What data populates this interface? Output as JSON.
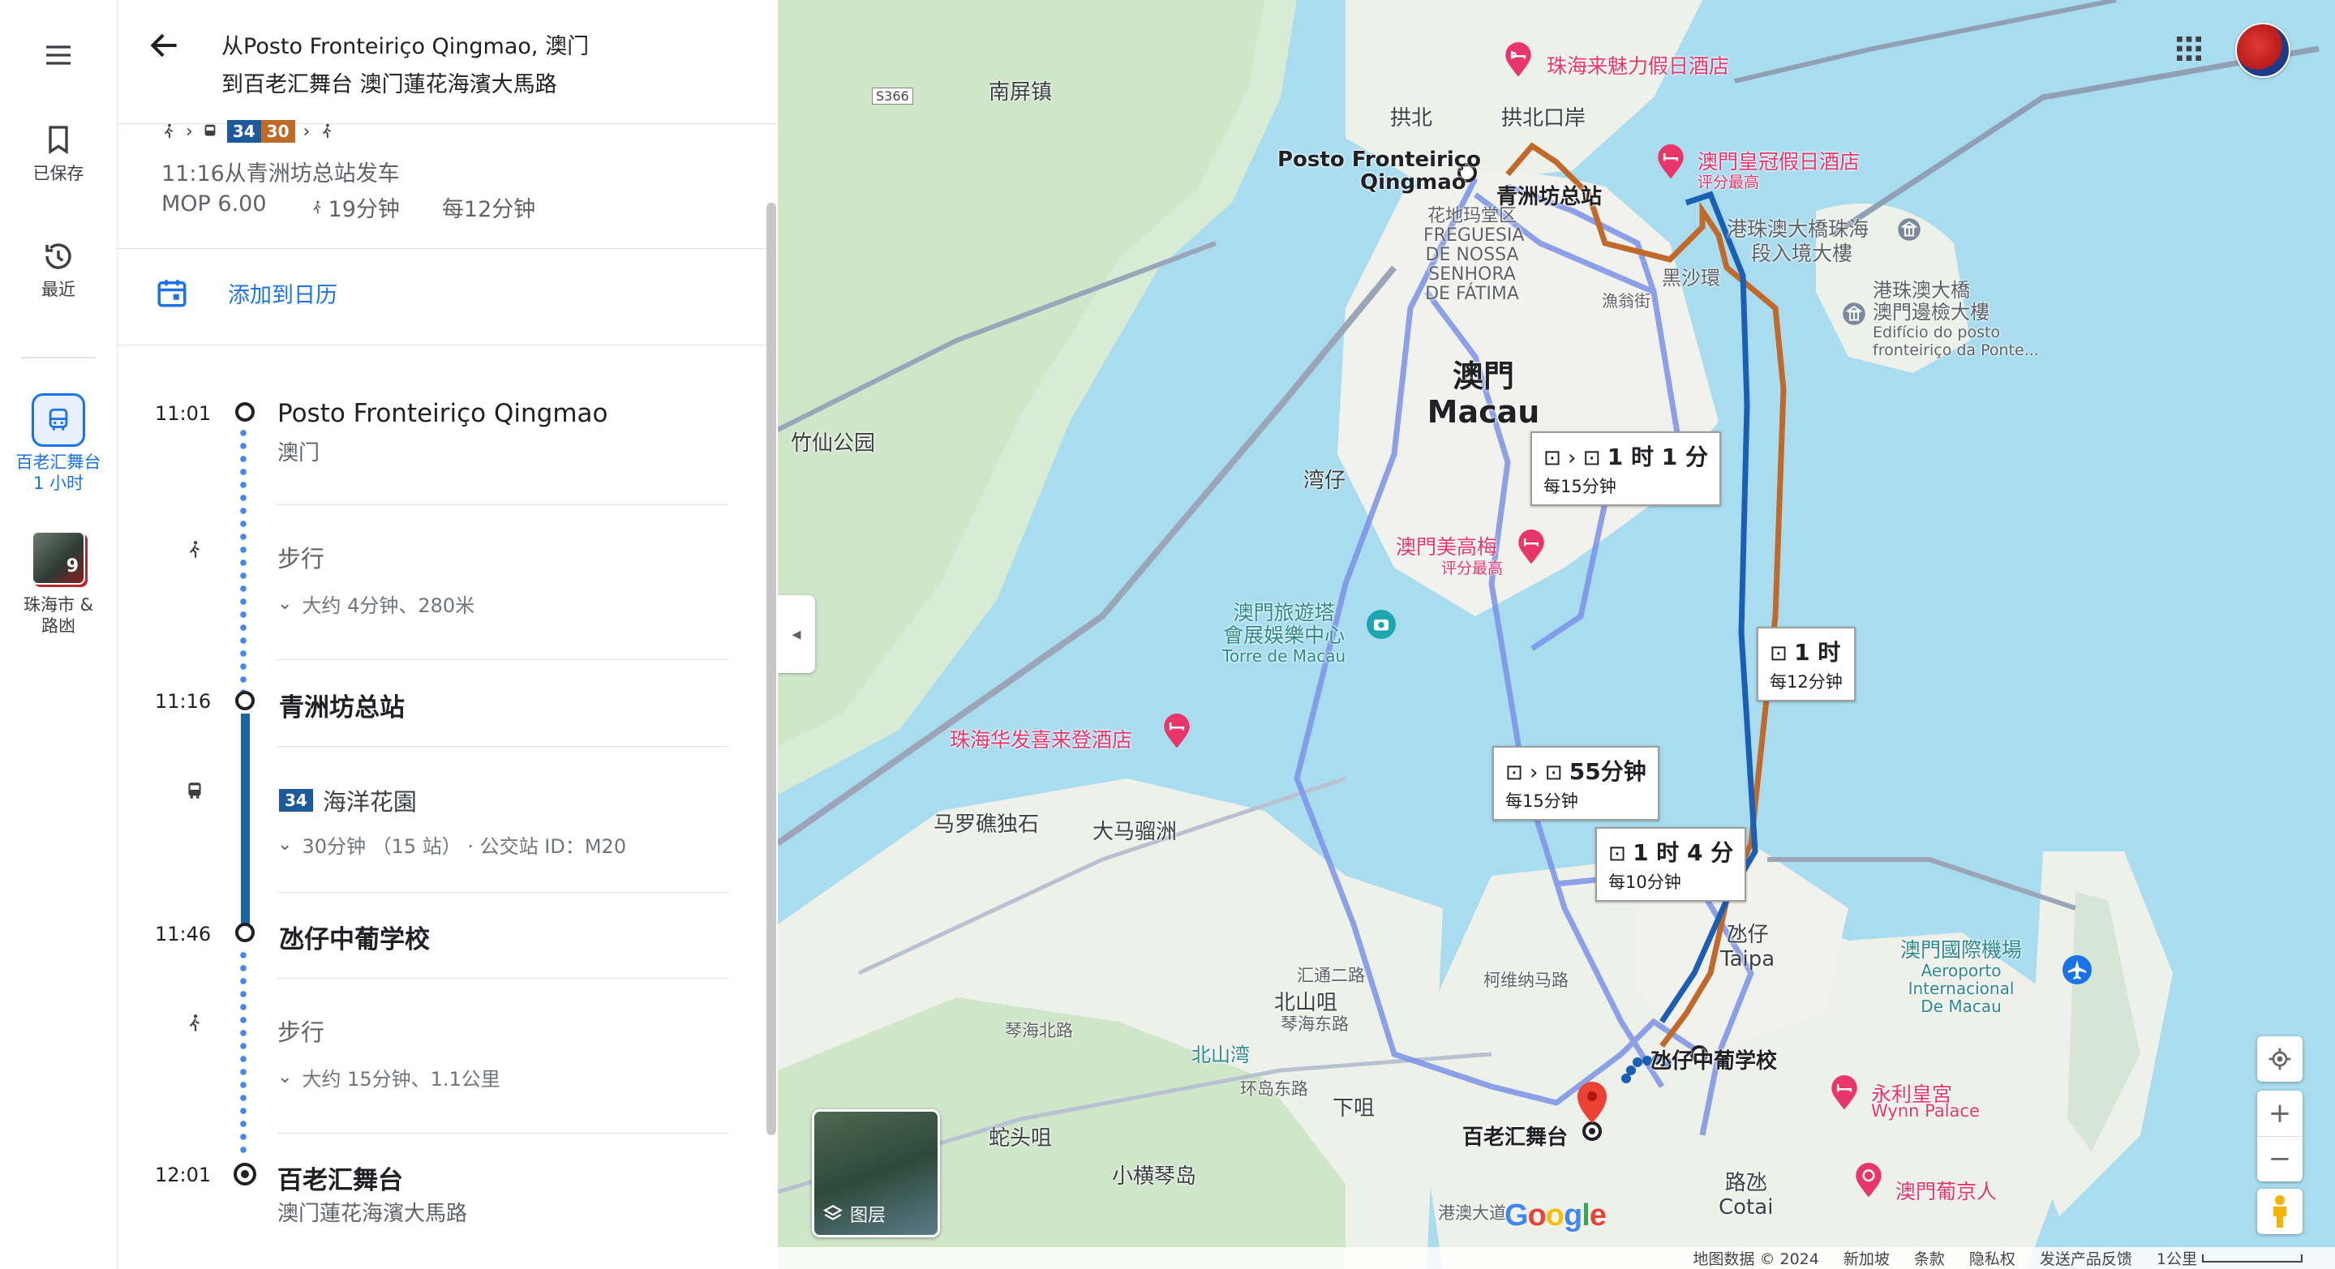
{
  "rail": {
    "saved_label": "已保存",
    "recent_label": "最近",
    "active_trip_label": "百老汇舞台",
    "active_trip_time": "1 小时",
    "thumb_count": "9",
    "thumb_label_1": "珠海市 &",
    "thumb_label_2": "路凼"
  },
  "header": {
    "from_text": "从Posto Fronteiriço Qingmao, 澳门",
    "to_text": "到百老汇舞台 澳门蓮花海濱大馬路"
  },
  "summary": {
    "bus_badge_1": "34",
    "bus_badge_2": "30",
    "depart_text": "11:16从青洲坊总站发车",
    "fare": "MOP 6.00",
    "walk_time": "19分钟",
    "frequency": "每12分钟"
  },
  "calendar": {
    "label": "添加到日历"
  },
  "steps": [
    {
      "time": "11:01",
      "name": "Posto Fronteiriço Qingmao",
      "sub": "澳门"
    },
    {
      "mode": "步行",
      "detail": "大约 4分钟、280米"
    },
    {
      "time": "11:16",
      "name": "青洲坊总站"
    },
    {
      "bus": "34",
      "dest": "海洋花園",
      "detail": "30分钟 （15 站） · 公交站 ID：M20"
    },
    {
      "time": "11:46",
      "name": "氹仔中葡学校"
    },
    {
      "mode": "步行",
      "detail": "大约 15分钟、1.1公里"
    },
    {
      "time": "12:01",
      "name": "百老汇舞台",
      "sub": "澳门蓮花海濱大馬路"
    }
  ],
  "map": {
    "labels": {
      "nanping": "南屏镇",
      "gongbei": "拱北",
      "gongbei_port": "拱北口岸",
      "posto_1": "Posto Fronteiriço",
      "posto_2": "Qingmao",
      "qingzhou": "青洲坊总站",
      "fatima_1": "花地玛堂区",
      "fatima_2": "FREGUESIA",
      "fatima_3": "DE NOSSA",
      "fatima_4": "SENHORA",
      "fatima_5": "DE FÁTIMA",
      "macau_cn": "澳門",
      "macau_en": "Macau",
      "wanzai": "湾仔",
      "zhuxian": "竹仙公园",
      "heishahuan": "黑沙環",
      "yuweitang": "漁翁街",
      "maluo": "马罗礁独石",
      "damaliuzhou": "大马骝洲",
      "beishanzui": "北山咀",
      "xiaju": "下咀",
      "shetouju": "蛇头咀",
      "xiaohengqin": "小横琴岛",
      "taipa_cn": "氹仔",
      "taipa_en": "Taipa",
      "cotai_cn": "路氹",
      "cotai_en": "Cotai",
      "school": "氹仔中葡学校",
      "broadway": "百老汇舞台",
      "port_1": "港珠澳大橋珠海",
      "port_2": "段入境大樓",
      "border_1": "港珠澳大橋",
      "border_2": "澳門邊檢大樓",
      "border_3": "Edifício do posto",
      "border_4": "fronteiriço da Ponte...",
      "airport_1": "澳門國際機場",
      "airport_2": "Aeroporto",
      "airport_3": "Internacional",
      "airport_4": "De Macau",
      "tower_1": "澳門旅遊塔",
      "tower_2": "會展娛樂中心",
      "tower_3": "Torre de Macau",
      "huiyuan": "汇通二路",
      "kewei": "柯维纳马路",
      "s366": "S366",
      "beishanwan": "北山湾",
      "zhuhai_zhongda": "港澳大道",
      "hengqin_bridge": "环岛东路",
      "qinhai": "琴海北路",
      "qinhai_e": "琴海东路"
    },
    "pois": {
      "holiday_inn": "珠海来魅力假日酒店",
      "crown_1": "澳門皇冠假日酒店",
      "crown_2": "评分最高",
      "mgm_1": "澳門美高梅",
      "mgm_2": "评分最高",
      "huafa": "珠海华发喜来登酒店",
      "wynn_1": "永利皇宮",
      "wynn_2": "Wynn Palace",
      "lisboa": "澳門葡京人"
    },
    "route_boxes": [
      {
        "duration": "1 时 1 分",
        "freq": "每15分钟"
      },
      {
        "duration": "1 时",
        "freq": "每12分钟"
      },
      {
        "duration": "55分钟",
        "freq": "每15分钟"
      },
      {
        "duration": "1 时 4 分",
        "freq": "每10分钟"
      }
    ],
    "layers_label": "图层",
    "google_logo": "Google",
    "footer": {
      "map_data": "地图数据 © 2024",
      "region": "新加坡",
      "terms": "条款",
      "privacy": "隐私权",
      "feedback": "发送产品反馈",
      "scale": "1公里"
    }
  },
  "colors": {
    "route_blue": "#1a5fb4",
    "route_orange": "#c0692b",
    "alt_route": "#7b93e8",
    "water": "#a9dcef",
    "land": "#e9efe8",
    "accent_blue": "#1a73e8",
    "poi_pink": "#e8366b"
  }
}
